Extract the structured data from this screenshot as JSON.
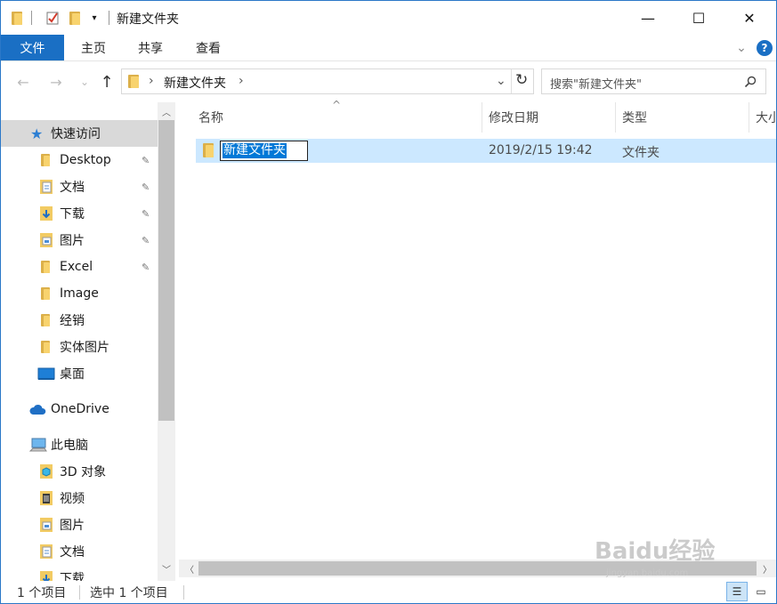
{
  "window": {
    "title": "新建文件夹",
    "controls": {
      "minimize": "—",
      "maximize": "☐",
      "close": "✕"
    }
  },
  "ribbon": {
    "tabs": [
      "文件",
      "主页",
      "共享",
      "查看"
    ],
    "expand_icon": "⌄",
    "help_label": "?"
  },
  "nav": {
    "back_icon": "←",
    "forward_icon": "→",
    "recent_icon": "⌄",
    "up_icon": "↑",
    "address_separator": "›",
    "address_path": "新建文件夹",
    "address_dropdown_icon": "⌄",
    "refresh_icon": "↻",
    "search_placeholder": "搜索\"新建文件夹\"",
    "search_icon": "⚲"
  },
  "sidebar": {
    "items": [
      {
        "label": "快速访问",
        "icon": "star-icon",
        "level": 0
      },
      {
        "label": "Desktop",
        "icon": "folder-icon",
        "level": 1,
        "pinned": true
      },
      {
        "label": "文档",
        "icon": "documents-icon",
        "level": 1,
        "pinned": true
      },
      {
        "label": "下载",
        "icon": "downloads-icon",
        "level": 1,
        "pinned": true
      },
      {
        "label": "图片",
        "icon": "pictures-icon",
        "level": 1,
        "pinned": true
      },
      {
        "label": "Excel",
        "icon": "folder-icon",
        "level": 1,
        "pinned": true
      },
      {
        "label": "Image",
        "icon": "folder-icon",
        "level": 1
      },
      {
        "label": "经销",
        "icon": "folder-icon",
        "level": 1
      },
      {
        "label": "实体图片",
        "icon": "folder-icon",
        "level": 1
      },
      {
        "label": "桌面",
        "icon": "desktop-icon",
        "level": 1
      },
      {
        "label": "OneDrive",
        "icon": "cloud-icon",
        "level": 0
      },
      {
        "label": "此电脑",
        "icon": "pc-icon",
        "level": 0
      },
      {
        "label": "3D 对象",
        "icon": "3d-objects-icon",
        "level": 1
      },
      {
        "label": "视频",
        "icon": "videos-icon",
        "level": 1
      },
      {
        "label": "图片",
        "icon": "pictures-icon",
        "level": 1
      },
      {
        "label": "文档",
        "icon": "documents-icon",
        "level": 1
      },
      {
        "label": "下载",
        "icon": "downloads-icon",
        "level": 1
      }
    ],
    "pin_glyph": "📌"
  },
  "list": {
    "sort_glyph": "^",
    "columns": [
      "名称",
      "修改日期",
      "类型",
      "大小"
    ],
    "rows": [
      {
        "name": "新建文件夹",
        "modified": "2019/2/15 19:42",
        "type": "文件夹",
        "selected": true,
        "renaming": true
      }
    ]
  },
  "status": {
    "item_count": "1 个项目",
    "selected_count": "选中 1 个项目"
  },
  "watermark": {
    "text": "Baidu经验",
    "url": "jingyan.baidu.com"
  }
}
